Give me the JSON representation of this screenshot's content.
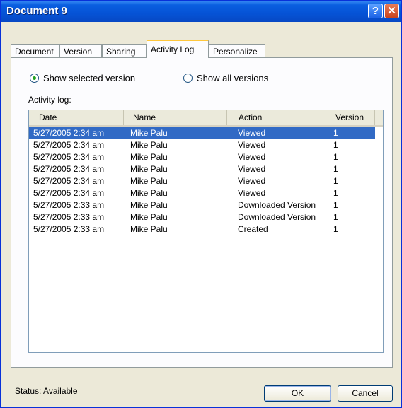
{
  "window": {
    "title": "Document 9"
  },
  "tabs": [
    {
      "label": "Document"
    },
    {
      "label": "Version"
    },
    {
      "label": "Sharing"
    },
    {
      "label": "Activity Log",
      "active": true
    },
    {
      "label": "Personalize"
    }
  ],
  "options": {
    "selected_version": "Show selected version",
    "all_versions": "Show all versions",
    "selected": "selected_version"
  },
  "log": {
    "label": "Activity log:",
    "columns": [
      "Date",
      "Name",
      "Action",
      "Version"
    ],
    "rows": [
      {
        "date": "5/27/2005 2:34 am",
        "name": "Mike Palu",
        "action": "Viewed",
        "version": "1",
        "selected": true
      },
      {
        "date": "5/27/2005 2:34 am",
        "name": "Mike Palu",
        "action": "Viewed",
        "version": "1"
      },
      {
        "date": "5/27/2005 2:34 am",
        "name": "Mike Palu",
        "action": "Viewed",
        "version": "1"
      },
      {
        "date": "5/27/2005 2:34 am",
        "name": "Mike Palu",
        "action": "Viewed",
        "version": "1"
      },
      {
        "date": "5/27/2005 2:34 am",
        "name": "Mike Palu",
        "action": "Viewed",
        "version": "1"
      },
      {
        "date": "5/27/2005 2:34 am",
        "name": "Mike Palu",
        "action": "Viewed",
        "version": "1"
      },
      {
        "date": "5/27/2005 2:33 am",
        "name": "Mike Palu",
        "action": "Downloaded Version",
        "version": "1"
      },
      {
        "date": "5/27/2005 2:33 am",
        "name": "Mike Palu",
        "action": "Downloaded Version",
        "version": "1"
      },
      {
        "date": "5/27/2005 2:33 am",
        "name": "Mike Palu",
        "action": "Created",
        "version": "1"
      }
    ]
  },
  "status": {
    "text": "Status: Available"
  },
  "buttons": {
    "ok": "OK",
    "cancel": "Cancel"
  }
}
